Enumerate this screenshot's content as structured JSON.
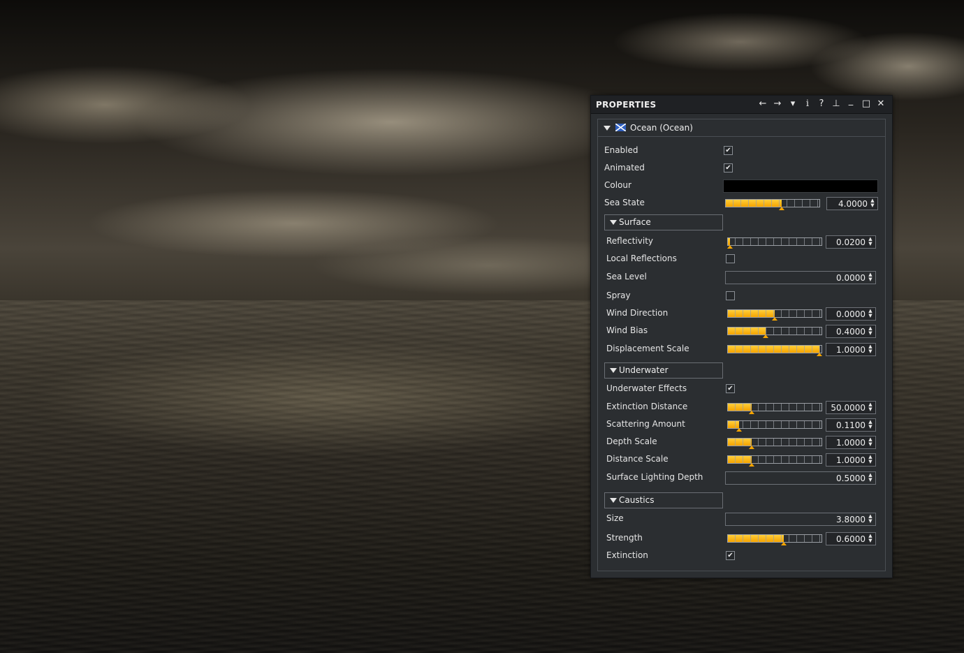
{
  "viewport": {
    "description_icon": "ocean-scene"
  },
  "panel": {
    "title": "PROPERTIES",
    "toolbar_icons": [
      "back-arrow-icon",
      "forward-arrow-icon",
      "dropdown-icon",
      "info-icon",
      "help-icon",
      "pin-icon",
      "minimize-icon",
      "maximize-icon",
      "close-icon"
    ],
    "object": {
      "label": "Ocean (Ocean)",
      "icon": "ocean-flag-icon"
    }
  },
  "glyphs": {
    "back": "←",
    "forward": "→",
    "dropdown": "▾",
    "info": "i",
    "help": "?",
    "pin": "⊥",
    "minimize": "_",
    "maximize": "□",
    "close": "✕",
    "check": "✔",
    "up": "▲",
    "down": "▼"
  },
  "general": {
    "enabled": {
      "label": "Enabled",
      "checked": true
    },
    "animated": {
      "label": "Animated",
      "checked": true
    },
    "colour": {
      "label": "Colour",
      "value": "#000000"
    },
    "sea_state": {
      "label": "Sea State",
      "value": "4.0000",
      "fraction": 0.6
    }
  },
  "surface": {
    "title": "Surface",
    "reflectivity": {
      "label": "Reflectivity",
      "value": "0.0200",
      "fraction": 0.02
    },
    "local_reflections": {
      "label": "Local Reflections",
      "checked": false
    },
    "sea_level": {
      "label": "Sea Level",
      "value": "0.0000"
    },
    "spray": {
      "label": "Spray",
      "checked": false
    },
    "wind_direction": {
      "label": "Wind Direction",
      "value": "0.0000",
      "fraction": 0.5
    },
    "wind_bias": {
      "label": "Wind Bias",
      "value": "0.4000",
      "fraction": 0.4
    },
    "displacement_scale": {
      "label": "Displacement Scale",
      "value": "1.0000",
      "fraction": 0.98
    }
  },
  "underwater": {
    "title": "Underwater",
    "underwater_effects": {
      "label": "Underwater Effects",
      "checked": true
    },
    "extinction_distance": {
      "label": "Extinction Distance",
      "value": "50.0000",
      "fraction": 0.25
    },
    "scattering_amount": {
      "label": "Scattering Amount",
      "value": "0.1100",
      "fraction": 0.12
    },
    "depth_scale": {
      "label": "Depth Scale",
      "value": "1.0000",
      "fraction": 0.25
    },
    "distance_scale": {
      "label": "Distance Scale",
      "value": "1.0000",
      "fraction": 0.25
    },
    "surface_lighting_depth": {
      "label": "Surface Lighting Depth",
      "value": "0.5000"
    }
  },
  "caustics": {
    "title": "Caustics",
    "size": {
      "label": "Size",
      "value": "3.8000"
    },
    "strength": {
      "label": "Strength",
      "value": "0.6000",
      "fraction": 0.6
    },
    "extinction": {
      "label": "Extinction",
      "checked": true
    }
  },
  "colors": {
    "accent": "#f5a400",
    "panel_bg": "#2b2e31",
    "titlebar_bg": "#1f2124"
  }
}
